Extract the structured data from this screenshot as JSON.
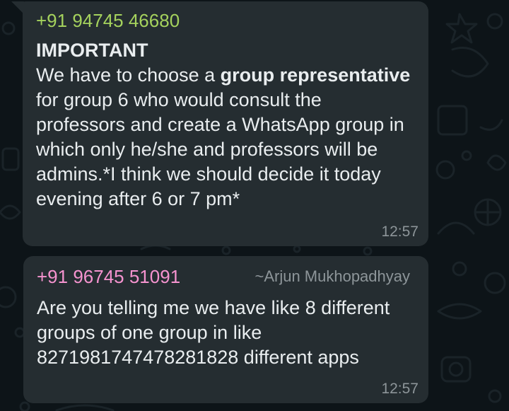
{
  "chat": {
    "messages": [
      {
        "sender": "+91 94745 46680",
        "heading": "IMPORTANT",
        "body_segments": [
          "We have to choose a ",
          "group representative",
          " for group 6 who would consult the professors and create a WhatsApp group in which only he/she and professors will be admins.*I think we should decide it today evening after 6 or 7 pm*"
        ],
        "time": "12:57"
      },
      {
        "sender": "+91 96745 51091",
        "push_name": "~Arjun Mukhopadhyay",
        "body": "Are you telling me we have like 8 different groups of one group in like 8271981747478281828 different apps",
        "time": "12:57"
      }
    ]
  },
  "colors": {
    "background": "#0d1418",
    "bubble": "#252d31",
    "sender_1": "#a5d25d",
    "sender_2": "#f593cf",
    "text": "#e9edef",
    "meta": "#8d9599"
  }
}
